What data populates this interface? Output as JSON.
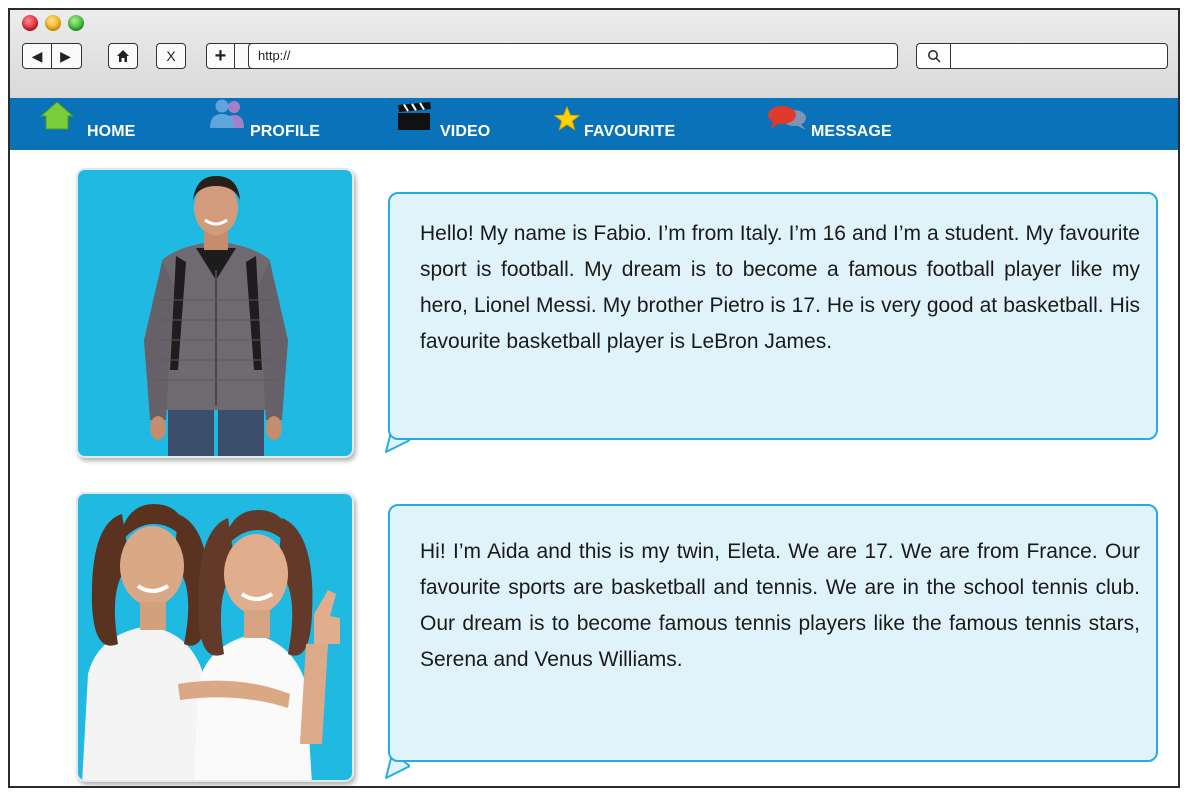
{
  "browser": {
    "address_bar": "http://",
    "nav_buttons": {
      "back": "◀",
      "forward": "▶",
      "stop": "X",
      "new_tab": "+"
    }
  },
  "nav": {
    "items": [
      {
        "label": "HOME",
        "icon": "home-icon"
      },
      {
        "label": "PROFILE",
        "icon": "profile-icon"
      },
      {
        "label": "VIDEO",
        "icon": "clapperboard-icon"
      },
      {
        "label": "FAVOURITE",
        "icon": "star-icon"
      },
      {
        "label": "MESSAGE",
        "icon": "speech-bubbles-icon"
      }
    ]
  },
  "posts": [
    {
      "text": "Hello! My name is Fabio. I’m from Italy. I’m 16 and I’m a student. My favourite sport is football. My dream is to become a famous football player like my hero, Lionel Messi. My brother Pietro is 17. He is very good at basketball. His favourite basketball player is LeBron James."
    },
    {
      "text": "Hi! I’m Aida and this is my twin, Eleta. We are 17. We are from France. Our favourite sports are basketball and tennis. We are in the school tennis club. Our dream is to become famous tennis players like the famous tennis stars, Serena and Venus Williams."
    }
  ],
  "colors": {
    "nav_bar": "#0a72b9",
    "bubble_fill": "#e0f3fb",
    "bubble_border": "#27abe0",
    "photo_background": "#1fb9e2"
  }
}
